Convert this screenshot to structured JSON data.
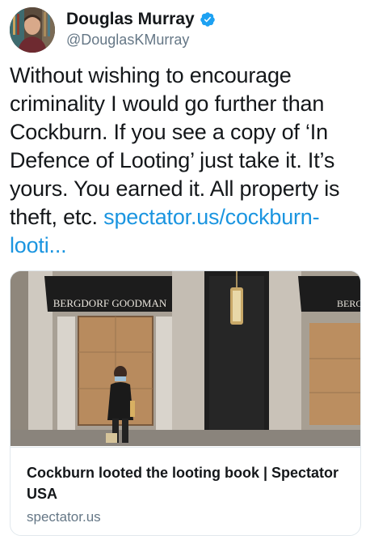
{
  "author": {
    "display_name": "Douglas Murray",
    "handle": "@DouglasKMurray",
    "verified": true,
    "verified_icon": "verified-badge-icon"
  },
  "tweet": {
    "text": "Without wishing to encourage criminality I would go further than Cockburn. If you see a copy of ‘In Defence of Looting’ just take it. It’s yours. You earned it. All property is theft, etc.",
    "link_text": "spectator.us/cockburn-looti...",
    "link_color": "#1b95e0"
  },
  "card": {
    "image": {
      "store_sign": "BERGDORF GOODMAN",
      "store_sign_partial": "BERG"
    },
    "title": "Cockburn looted the looting book | Spectator USA",
    "domain": "spectator.us"
  },
  "colors": {
    "text": "#14171a",
    "secondary": "#657786",
    "verified_blue": "#1da1f2",
    "card_border": "#e1e8ed"
  }
}
